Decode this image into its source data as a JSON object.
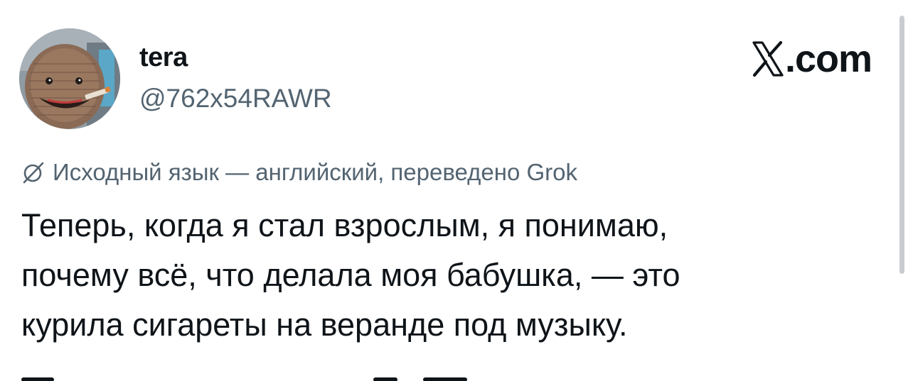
{
  "author": {
    "display_name": "tera",
    "handle": "@762x54RAWR",
    "avatar_icon": "knitted-doll-avatar"
  },
  "brand": {
    "label": ".com",
    "icon": "x-logo-icon"
  },
  "translation": {
    "icon": "grok-icon",
    "note": "Исходный язык — английский, переведено Grok"
  },
  "tweet": {
    "lines": [
      "Теперь, когда я стал взрослым, я понимаю,",
      "почему всё, что делала моя бабушка, — это",
      "курила сигареты на веранде под музыку."
    ]
  },
  "colors": {
    "text_primary": "#0f1419",
    "text_secondary": "#536471",
    "background": "#ffffff"
  }
}
